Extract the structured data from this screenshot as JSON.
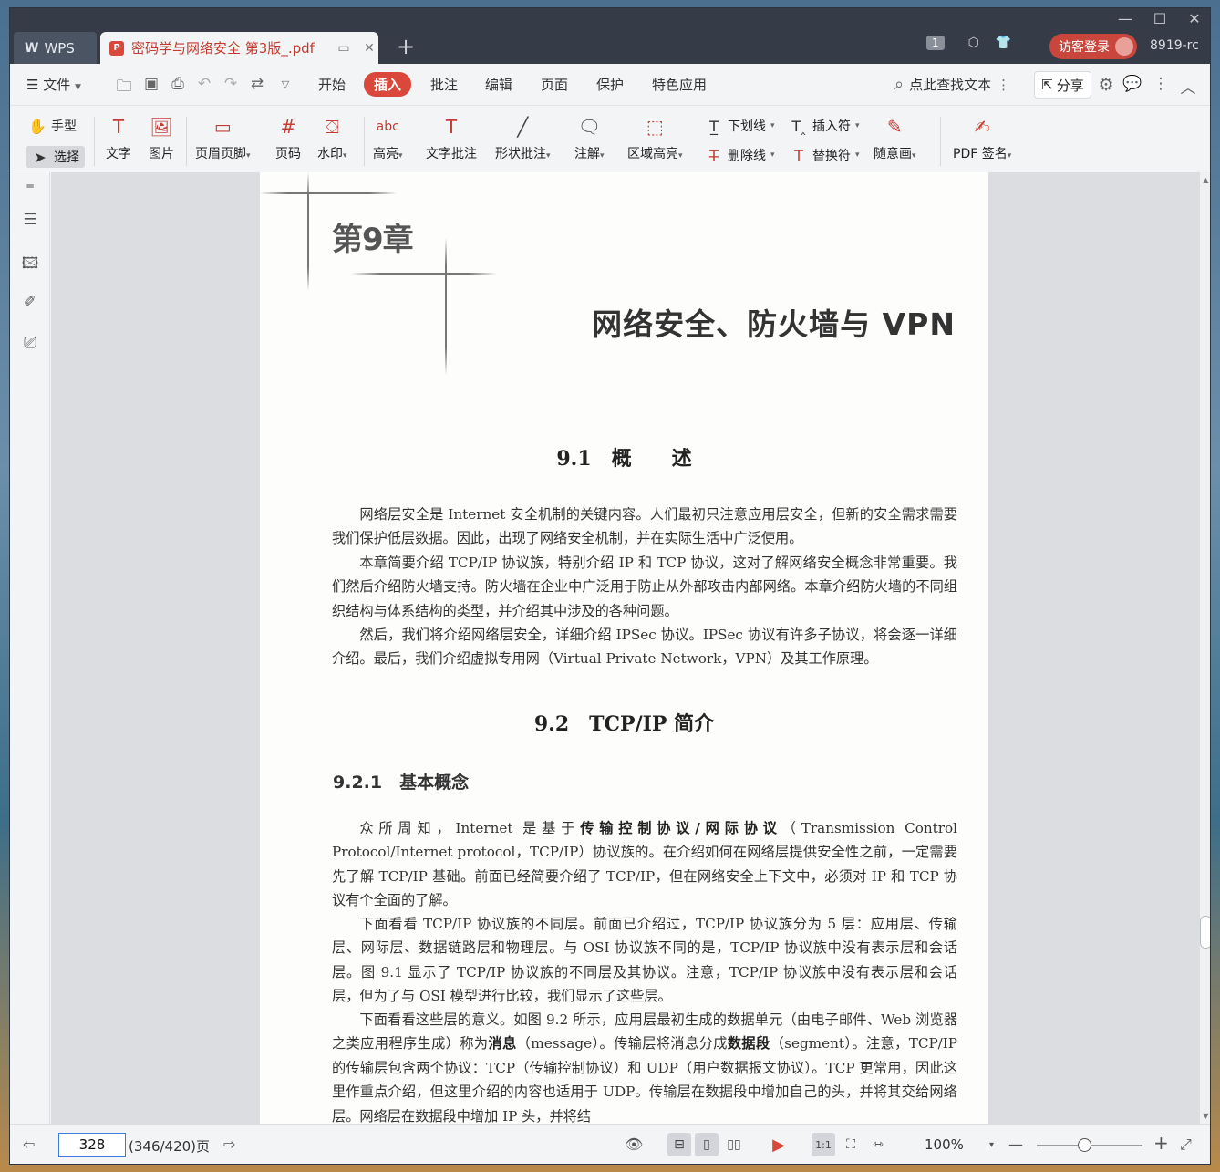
{
  "titlebar": {
    "app_tab": "WPS",
    "doc_tab": "密码学与网络安全 第3版_.pdf",
    "page_badge": "1",
    "login": "访客登录",
    "user_id": "8919-rc"
  },
  "menubar": {
    "file": "文件",
    "items": [
      "开始",
      "插入",
      "批注",
      "编辑",
      "页面",
      "保护",
      "特色应用"
    ],
    "active": "插入",
    "search": "点此查找文本",
    "share": "分享"
  },
  "ribbon": {
    "hand": "手型",
    "select": "选择",
    "text": "文字",
    "image": "图片",
    "header_footer": "页眉页脚",
    "page_number": "页码",
    "watermark": "水印",
    "highlight": "高亮",
    "text_comment": "文字批注",
    "shape_comment": "形状批注",
    "annotation": "注解",
    "area_highlight": "区域高亮",
    "underline": "下划线",
    "strikethrough": "删除线",
    "insert_mark": "插入符",
    "replace_mark": "替换符",
    "freehand": "随意画",
    "pdf_sign": "PDF 签名"
  },
  "document": {
    "chapter_no": "第9章",
    "chapter_title": "网络安全、防火墙与 VPN",
    "sec91": "9.1　概　　述",
    "p1": "网络层安全是 Internet 安全机制的关键内容。人们最初只注意应用层安全，但新的安全需求需要我们保护低层数据。因此，出现了网络安全机制，并在实际生活中广泛使用。",
    "p2": "本章简要介绍 TCP/IP 协议族，特别介绍 IP 和 TCP 协议，这对了解网络安全概念非常重要。我们然后介绍防火墙支持。防火墙在企业中广泛用于防止从外部攻击内部网络。本章介绍防火墙的不同组织结构与体系结构的类型，并介绍其中涉及的各种问题。",
    "p3": "然后，我们将介绍网络层安全，详细介绍 IPSec 协议。IPSec 协议有许多子协议，将会逐一详细介绍。最后，我们介绍虚拟专用网（Virtual Private Network，VPN）及其工作原理。",
    "sec92": "9.2　TCP/IP 简介",
    "sec921": "9.2.1　基本概念",
    "p4_pre": "众所周知，Internet 是基于",
    "p4_bold": "传输控制协议/网际协议",
    "p4_post": "（Transmission Control Protocol/Internet protocol，TCP/IP）协议族的。在介绍如何在网络层提供安全性之前，一定需要先了解 TCP/IP 基础。前面已经简要介绍了 TCP/IP，但在网络安全上下文中，必须对 IP 和 TCP 协议有个全面的了解。",
    "p5": "下面看看 TCP/IP 协议族的不同层。前面已介绍过，TCP/IP 协议族分为 5 层：应用层、传输层、网际层、数据链路层和物理层。与 OSI 协议族不同的是，TCP/IP 协议族中没有表示层和会话层。图 9.1 显示了 TCP/IP 协议族的不同层及其协议。注意，TCP/IP 协议族中没有表示层和会话层，但为了与 OSI 模型进行比较，我们显示了这些层。",
    "p6_a": "下面看看这些层的意义。如图 9.2 所示，应用层最初生成的数据单元（由电子邮件、Web 浏览器之类应用程序生成）称为",
    "p6_b1": "消息",
    "p6_c": "（message）。传输层将消息分成",
    "p6_b2": "数据段",
    "p6_d": "（segment）。注意，TCP/IP 的传输层包含两个协议：TCP（传输控制协议）和 UDP（用户数据报文协议）。TCP 更常用，因此这里作重点介绍，但这里介绍的内容也适用于 UDP。传输层在数据段中增加自己的头，并将其交给网络层。网络层在数据段中增加 IP 头，并将结"
  },
  "statusbar": {
    "page_input": "328",
    "page_count": "(346/420)页",
    "zoom": "100%",
    "zoom_level": 0.45
  },
  "colors": {
    "accent": "#d9483b",
    "titlebar": "#363c47"
  }
}
